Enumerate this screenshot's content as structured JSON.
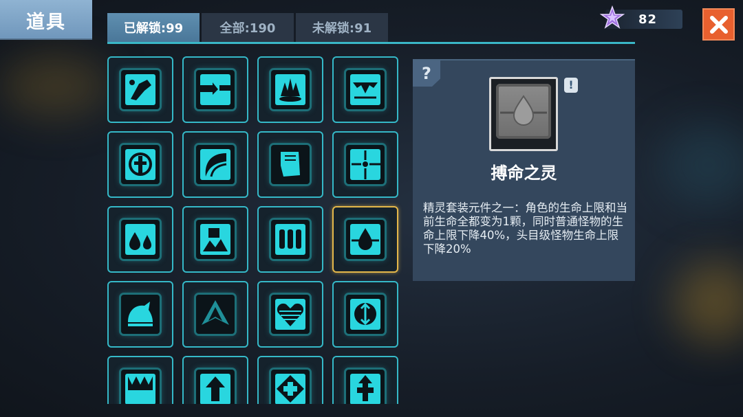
{
  "header": {
    "title": "道具"
  },
  "tabs": [
    {
      "label": "已解锁:99",
      "active": true
    },
    {
      "label": "全部:190",
      "active": false
    },
    {
      "label": "未解锁:91",
      "active": false
    }
  ],
  "currency": {
    "icon": "purple-star-icon",
    "value": "82"
  },
  "close": {
    "icon": "close-icon",
    "color": "#e8602f"
  },
  "grid": {
    "items": [
      {
        "icon": "arm-cannon-icon",
        "selected": false
      },
      {
        "icon": "split-squares-icon",
        "selected": false
      },
      {
        "icon": "spike-burst-icon",
        "selected": false
      },
      {
        "icon": "fang-jaw-icon",
        "selected": false
      },
      {
        "icon": "holy-cross-icon",
        "selected": false
      },
      {
        "icon": "wave-slash-icon",
        "selected": false
      },
      {
        "icon": "fist-icon",
        "selected": false
      },
      {
        "icon": "crosshair-icon",
        "selected": false
      },
      {
        "icon": "double-drop-icon",
        "selected": false
      },
      {
        "icon": "blocks-burst-icon",
        "selected": false
      },
      {
        "icon": "triple-bars-icon",
        "selected": false
      },
      {
        "icon": "spirit-drop-icon",
        "selected": true
      },
      {
        "icon": "helmet-icon",
        "selected": false
      },
      {
        "icon": "tri-blade-icon",
        "selected": false
      },
      {
        "icon": "striped-heart-icon",
        "selected": false
      },
      {
        "icon": "arrow-circle-icon",
        "selected": false
      },
      {
        "icon": "spike-frame-icon",
        "selected": false
      },
      {
        "icon": "up-arrow-icon",
        "selected": false
      },
      {
        "icon": "cross-diamond-icon",
        "selected": false
      },
      {
        "icon": "arrow-cross-icon",
        "selected": false
      }
    ]
  },
  "detail": {
    "help": "?",
    "alert": "!",
    "name": "搏命之灵",
    "description": "精灵套装元件之一：角色的生命上限和当前生命全都变为1颗，同时普通怪物的生命上限下降40%，头目级怪物生命上限下降20%"
  },
  "colors": {
    "accent": "#35b9c8",
    "selected": "#e4b74a",
    "panel": "#34475d",
    "tab_active": "#5f8fb0"
  }
}
